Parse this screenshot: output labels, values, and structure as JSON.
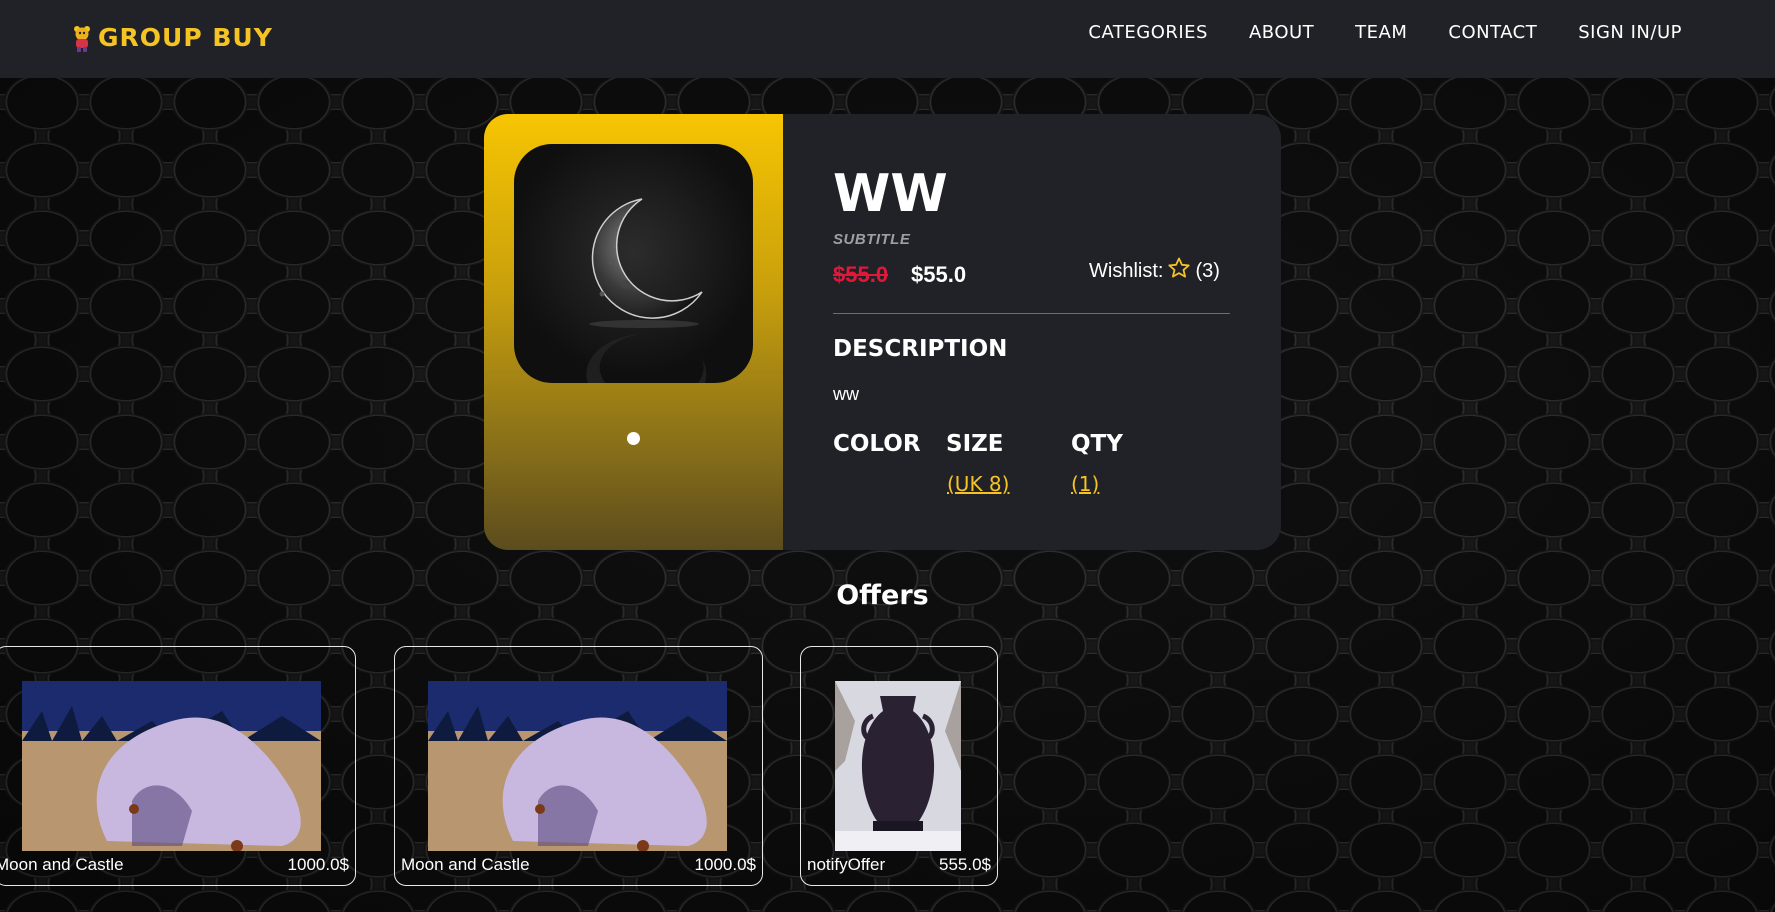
{
  "brand": {
    "name": "GROUP BUY",
    "logo": "bear-mascot-logo",
    "accent": "#f6c325"
  },
  "nav": [
    {
      "label": "CATEGORIES"
    },
    {
      "label": "ABOUT"
    },
    {
      "label": "TEAM"
    },
    {
      "label": "CONTACT"
    },
    {
      "label": "SIGN IN/UP"
    }
  ],
  "product": {
    "title": "WW",
    "subtitle": "SUBTITLE",
    "old_price": "$55.0",
    "new_price": "$55.0",
    "wishlist_label": "Wishlist:",
    "wishlist_icon": "star-outline-icon",
    "wishlist_count": "(3)",
    "description_heading": "DESCRIPTION",
    "description": "ww",
    "color_heading": "COLOR",
    "size_heading": "SIZE",
    "size_value": "(UK 8)",
    "qty_heading": "QTY",
    "qty_value": "(1)",
    "image": "crescent-moon-sculpture",
    "carousel_dots": 1,
    "old_price_color": "#e0193a"
  },
  "offers": {
    "heading": "Offers",
    "items": [
      {
        "name": "Moon and Castle",
        "price": "1000.0$",
        "image": "pink-blob-desert-render"
      },
      {
        "name": "Moon and Castle",
        "price": "1000.0$",
        "image": "pink-blob-desert-render"
      },
      {
        "name": "notifyOffer",
        "price": "555.0$",
        "image": "dark-vase-snow-render"
      }
    ]
  }
}
